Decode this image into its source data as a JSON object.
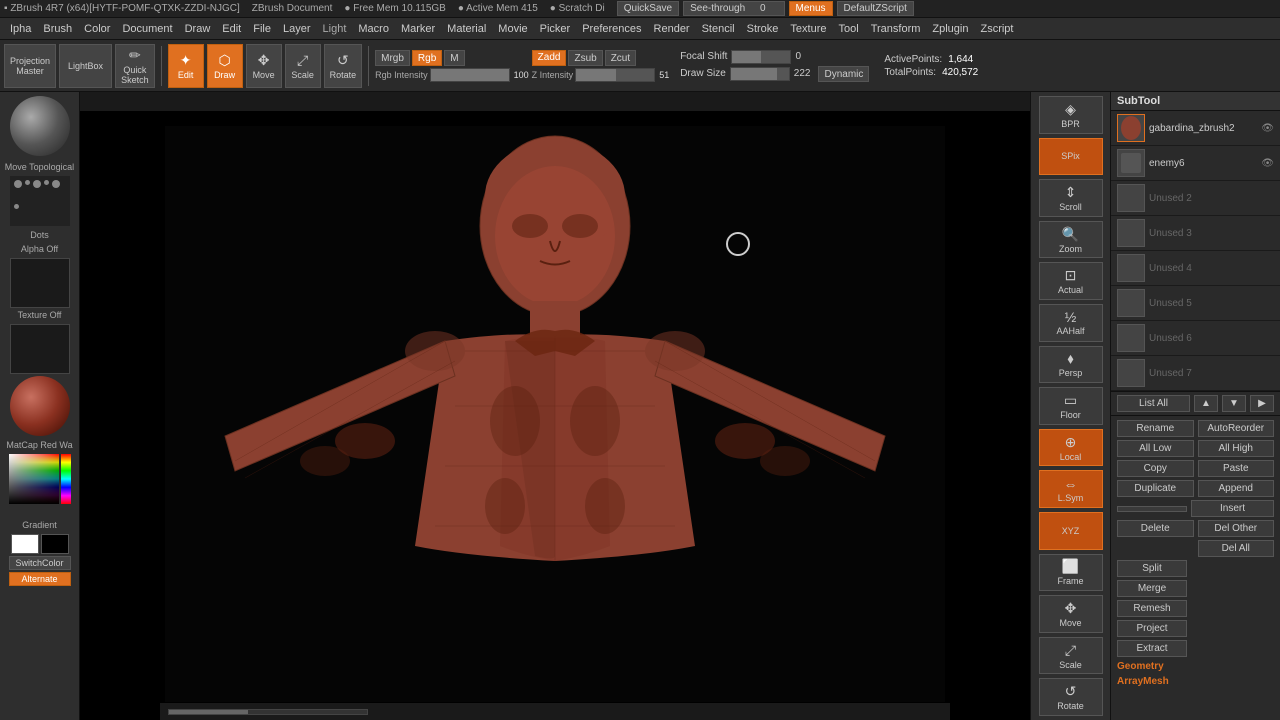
{
  "topbar": {
    "title": "▪ ZBrush 4R7 (x64)[HYTF-POMF-QTXK-ZZDI-NJGC]",
    "doc": "ZBrush Document",
    "freemem": "● Free Mem 10.115GB",
    "activemem": "● Active Mem 415",
    "scratch": "● Scratch Di",
    "quicksave": "QuickSave",
    "seethrough": "See-through",
    "seethrough_val": "0",
    "menus": "Menus",
    "defaultscript": "DefaultZScript"
  },
  "menubar": {
    "items": [
      "Ipha",
      "Brush",
      "Color",
      "Document",
      "Draw",
      "Edit",
      "File",
      "Layer",
      "Light",
      "Macro",
      "Marker",
      "Material",
      "Movie",
      "Picker",
      "Preferences",
      "Render",
      "Stencil",
      "Stroke",
      "Texture",
      "Tool",
      "Transform",
      "Zplugin",
      "Zscript"
    ]
  },
  "toolbar": {
    "projection_master": "Projection\nMaster",
    "lightbox": "LightBox",
    "quick_sketch": "Quick Sketch",
    "edit": "Edit",
    "draw": "Draw",
    "move": "Move",
    "scale": "Scale",
    "rotate": "Rotate",
    "mrgb": "Mrgb",
    "rgb": "Rgb",
    "m_btn": "M",
    "zadd": "Zadd",
    "zsub": "Zsub",
    "zcut": "Zcut",
    "focal_shift": "Focal Shift",
    "focal_val": "0",
    "active_points": "ActivePoints:",
    "active_val": "1,644",
    "total_points": "TotalPoints:",
    "total_val": "420,572",
    "rgb_intensity_label": "Rgb Intensity",
    "rgb_intensity_val": "100",
    "z_intensity_label": "Z Intensity",
    "z_intensity_val": "51",
    "draw_size_label": "Draw Size",
    "draw_size_val": "222",
    "dynamic": "Dynamic"
  },
  "left": {
    "alpha_label": "Alpha  Off",
    "texture_label": "Texture Off",
    "matcap_label": "MatCap Red Wa",
    "gradient_label": "Gradient",
    "switch_label": "SwitchColor",
    "alternate_label": "Alternate"
  },
  "viewport": {
    "move_topological": "Move Topological",
    "dots": "Dots"
  },
  "right_controls": {
    "bpr": "BPR",
    "spix": "SPix",
    "scroll": "Scroll",
    "zoom": "Zoom",
    "actual": "Actual",
    "aahalf": "AAHalf",
    "persp": "Persp",
    "floor": "Floor",
    "local": "Local",
    "lsym": "L.Sym",
    "xyz": "XYZ",
    "frame": "Frame",
    "move": "Move",
    "scale": "Scale",
    "rotate": "Rotate"
  },
  "subtool": {
    "header": "SubTool",
    "tools": [
      {
        "name": "gabardina_zbrush2",
        "active": true
      },
      {
        "name": "enemy6",
        "active": false
      },
      {
        "name": "Unused 2",
        "active": false,
        "dimmed": true
      },
      {
        "name": "Unused 3",
        "active": false,
        "dimmed": true
      },
      {
        "name": "Unused 4",
        "active": false,
        "dimmed": true
      },
      {
        "name": "Unused 5",
        "active": false,
        "dimmed": true
      },
      {
        "name": "Unused 6",
        "active": false,
        "dimmed": true
      },
      {
        "name": "Unused 7",
        "active": false,
        "dimmed": true
      }
    ],
    "list_all": "List All",
    "actions": {
      "rename": "Rename",
      "auto_reorder": "AutoReorder",
      "all_low": "All Low",
      "all_high": "All High",
      "copy": "Copy",
      "paste": "Paste",
      "duplicate": "Duplicate",
      "append": "Append",
      "insert": "Insert",
      "del_other": "Del Other",
      "delete": "Delete",
      "del_all": "Del All",
      "split": "Split",
      "merge": "Merge",
      "remesh": "Remesh",
      "project": "Project",
      "extract": "Extract",
      "geometry_label": "Geometry",
      "arraymesh_label": "ArrayMesh"
    }
  }
}
